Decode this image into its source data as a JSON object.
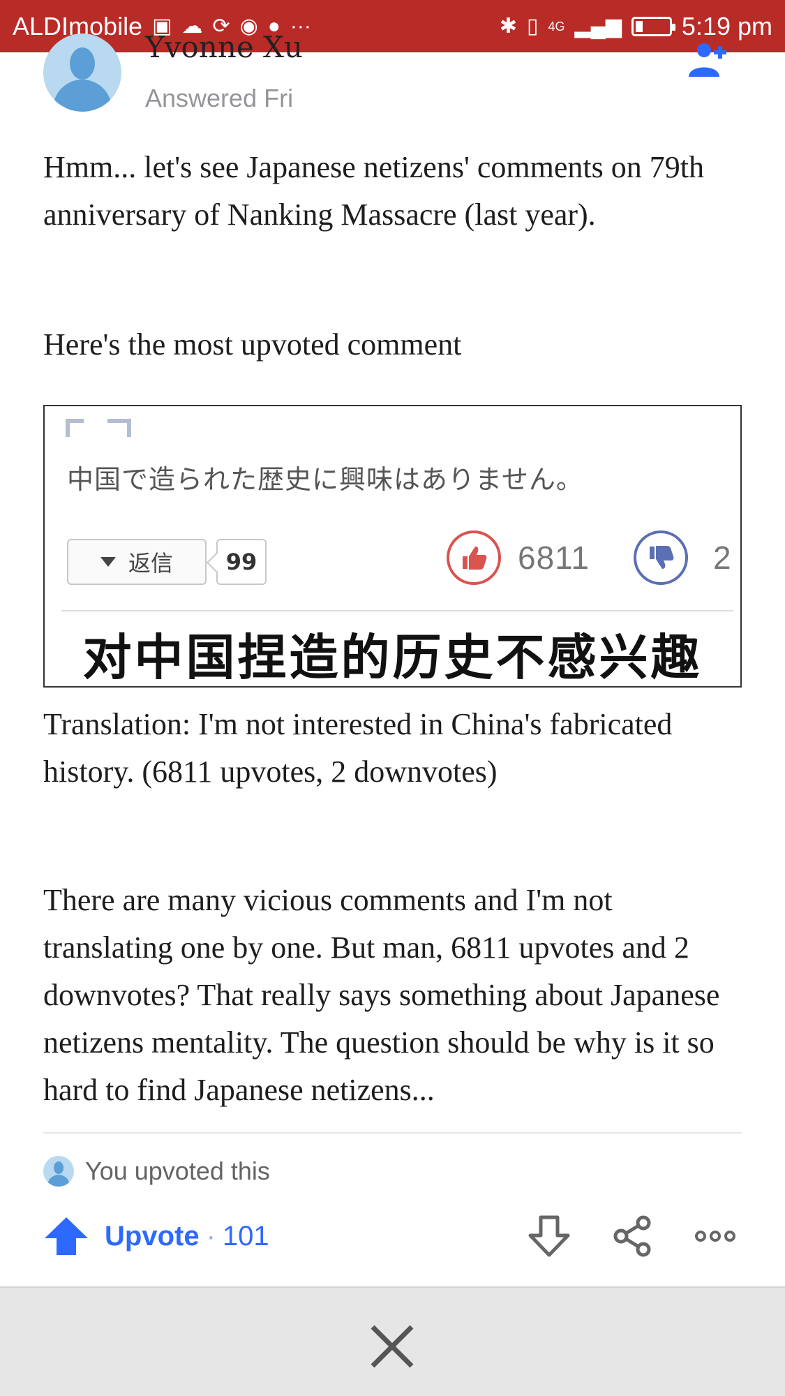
{
  "status_bar": {
    "carrier": "ALDImobile",
    "time": "5:19 pm",
    "network": "4G",
    "icons": [
      "gallery-icon",
      "cloud-icon",
      "sync-icon",
      "chrome-icon",
      "messenger-icon",
      "more-icon",
      "bluetooth-icon",
      "vibrate-icon",
      "signal-icon",
      "battery-icon"
    ],
    "more_glyph": "···"
  },
  "answer": {
    "author_name": "Yvonne Xu",
    "answered_label": "Answered Fri",
    "paragraphs": [
      "Hmm... let's see Japanese netizens' comments on 79th anniversary of Nanking Massacre (last year).",
      "Here's the most upvoted comment",
      "Translation: I'm not interested in China's fabricated history. (6811 upvotes, 2 downvotes)",
      "There are many vicious comments and I'm not translating one by one. But man, 6811 upvotes and 2 downvotes? That really says something about Japanese netizens mentality. The question should be why is it so hard to find Japanese netizens..."
    ]
  },
  "embedded_image": {
    "jp_comment": "中国で造られた歴史に興味はありません。",
    "reply_label": "返信",
    "reply_count": "99",
    "up_count": "6811",
    "down_count": "2",
    "cn_caption": "对中国捏造的历史不感兴趣"
  },
  "footer": {
    "upvoted_text": "You upvoted this",
    "upvote_label": "Upvote",
    "upvote_sep": "·",
    "upvote_count": "101"
  },
  "colors": {
    "status_bar": "#b92b27",
    "accent_blue": "#2e69ff",
    "thumb_up": "#d9534f",
    "thumb_down": "#5b6fb3"
  }
}
